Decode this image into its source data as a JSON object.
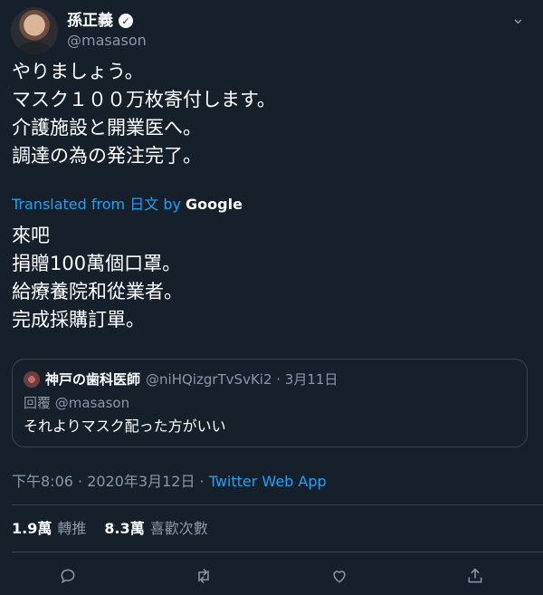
{
  "author": {
    "display_name": "孫正義",
    "handle": "@masason"
  },
  "tweet": {
    "lines": [
      "やりましょう。",
      "マスク１００万枚寄付します。",
      "介護施設と開業医へ。",
      "調達の為の発注完了。"
    ],
    "translated_prefix": "Translated from",
    "translated_lang": "日文",
    "translated_by": "by",
    "translated_provider": "Google",
    "translation_lines": [
      "來吧",
      "捐贈100萬個口罩。",
      "給療養院和從業者。",
      "完成採購訂單。"
    ]
  },
  "quoted": {
    "name": "神戸の歯科医師",
    "handle_date": "@niHQizgrTvSvKi2 · 3月11日",
    "reply_prefix": "回覆",
    "reply_to": "@masason",
    "text": "それよりマスク配った方がいい"
  },
  "meta": {
    "time": "下午8:06 · 2020年3月12日 · ",
    "app": "Twitter Web App"
  },
  "stats": {
    "retweets": "1.9萬",
    "retweets_label": "轉推",
    "likes": "8.3萬",
    "likes_label": "喜歡次數"
  },
  "icons": [
    "verified-icon",
    "chevron-down-icon",
    "reply-icon",
    "retweet-icon",
    "like-icon",
    "share-icon"
  ],
  "colors": {
    "background": "#15202b",
    "accent": "#1da1f2",
    "muted": "#8899a6",
    "border": "#38444d"
  }
}
